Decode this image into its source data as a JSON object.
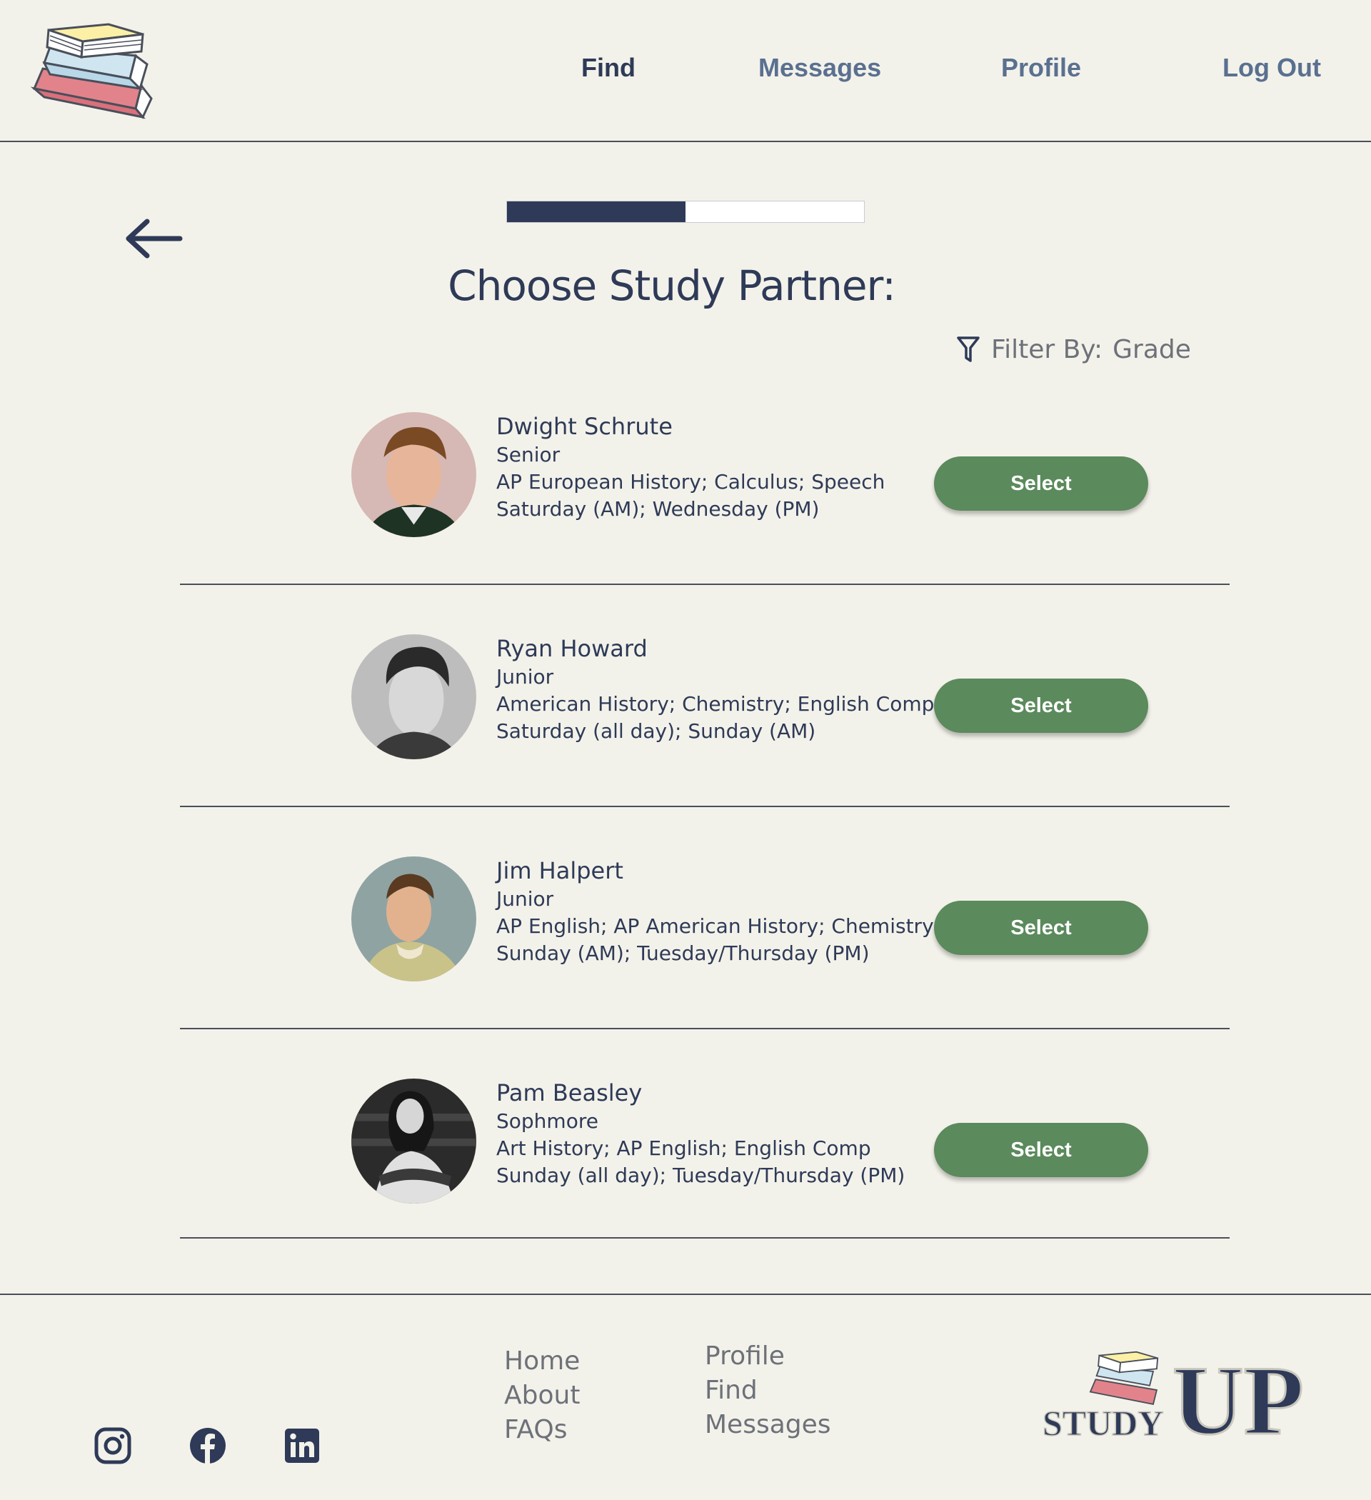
{
  "nav": {
    "find": "Find",
    "messages": "Messages",
    "profile": "Profile",
    "logout": "Log Out"
  },
  "progress": {
    "value": 0.5
  },
  "page": {
    "title": "Choose Study Partner:",
    "filter_label": "Filter By:",
    "filter_value": "Grade"
  },
  "partners": [
    {
      "name": "Dwight Schrute",
      "grade": "Senior",
      "subjects": "AP European History; Calculus; Speech",
      "availability": "Saturday (AM); Wednesday (PM)",
      "select_label": "Select"
    },
    {
      "name": "Ryan Howard",
      "grade": "Junior",
      "subjects": "American History; Chemistry; English Comp",
      "availability": "Saturday (all day); Sunday (AM)",
      "select_label": "Select"
    },
    {
      "name": "Jim Halpert",
      "grade": "Junior",
      "subjects": "AP English; AP American History; Chemistry",
      "availability": "Sunday (AM); Tuesday/Thursday (PM)",
      "select_label": "Select"
    },
    {
      "name": "Pam Beasley",
      "grade": "Sophmore",
      "subjects": "Art History; AP English; English Comp",
      "availability": "Sunday (all day);  Tuesday/Thursday (PM)",
      "select_label": "Select"
    }
  ],
  "footer": {
    "col1": [
      "Home",
      "About",
      "FAQs"
    ],
    "col2": [
      "Profile",
      "Find",
      "Messages"
    ],
    "brand_small": "STUDY",
    "brand_big": "UP",
    "social": [
      "instagram-icon",
      "facebook-icon",
      "linkedin-icon"
    ]
  },
  "colors": {
    "background": "#f3f2ea",
    "navy": "#2e3a57",
    "nav_inactive": "#5a7090",
    "button_green": "#5b8a5c",
    "muted_text": "#6d7179"
  }
}
